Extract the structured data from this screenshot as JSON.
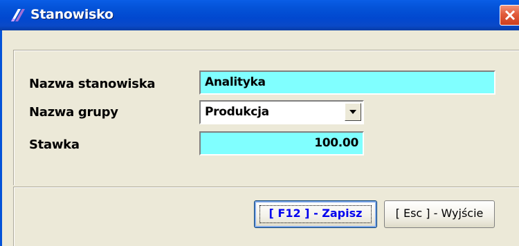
{
  "window": {
    "title": "Stanowisko",
    "close_icon": "close-icon",
    "app_icon": "app-logo-icon"
  },
  "form": {
    "position_name_label": "Nazwa stanowiska",
    "position_name_value": "Analityka",
    "group_name_label": "Nazwa grupy",
    "group_name_value": "Produkcja",
    "rate_label": "Stawka",
    "rate_value": "100.00"
  },
  "buttons": {
    "save_label": "[ F12 ] - Zapisz",
    "exit_label": "[ Esc ] - Wyjście"
  },
  "colors": {
    "title_bar": "#0453d8",
    "field_highlight": "#80ffff",
    "dialog_bg": "#ece9d8",
    "save_text": "#0000ee"
  }
}
